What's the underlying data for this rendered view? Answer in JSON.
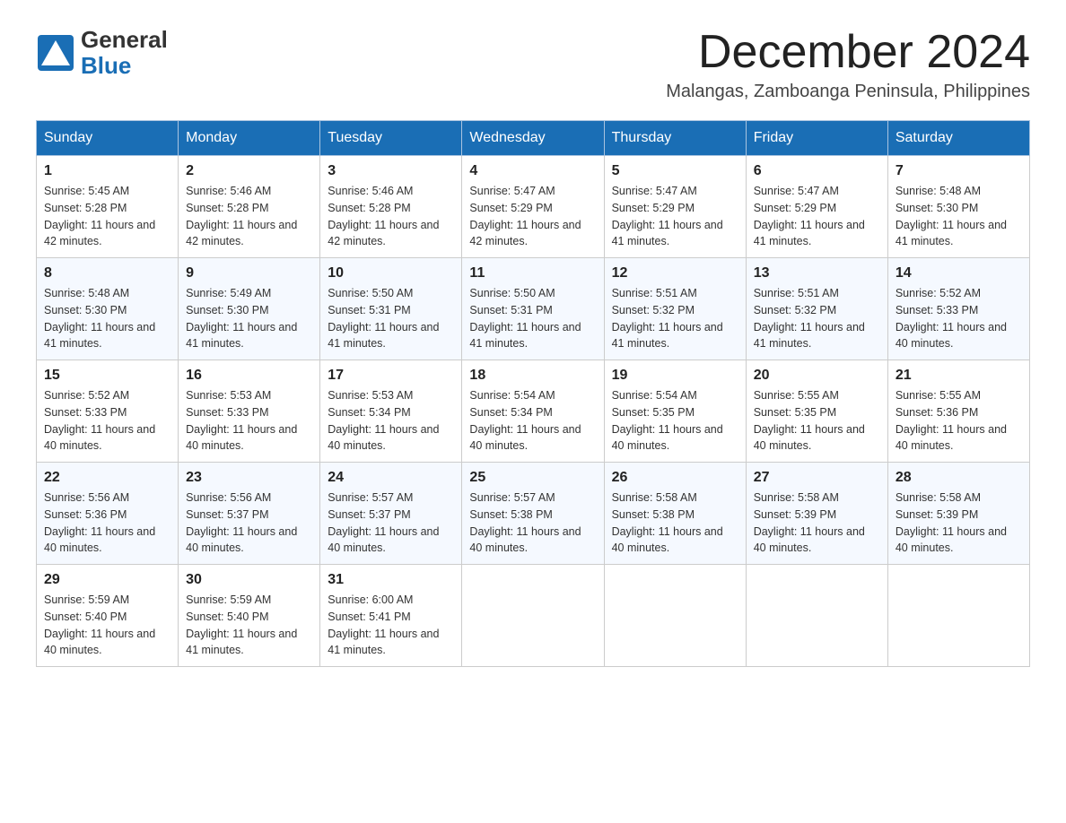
{
  "header": {
    "logo_general": "General",
    "logo_blue": "Blue",
    "month_title": "December 2024",
    "location": "Malangas, Zamboanga Peninsula, Philippines"
  },
  "weekdays": [
    "Sunday",
    "Monday",
    "Tuesday",
    "Wednesday",
    "Thursday",
    "Friday",
    "Saturday"
  ],
  "weeks": [
    [
      {
        "day": "1",
        "sunrise": "5:45 AM",
        "sunset": "5:28 PM",
        "daylight": "11 hours and 42 minutes."
      },
      {
        "day": "2",
        "sunrise": "5:46 AM",
        "sunset": "5:28 PM",
        "daylight": "11 hours and 42 minutes."
      },
      {
        "day": "3",
        "sunrise": "5:46 AM",
        "sunset": "5:28 PM",
        "daylight": "11 hours and 42 minutes."
      },
      {
        "day": "4",
        "sunrise": "5:47 AM",
        "sunset": "5:29 PM",
        "daylight": "11 hours and 42 minutes."
      },
      {
        "day": "5",
        "sunrise": "5:47 AM",
        "sunset": "5:29 PM",
        "daylight": "11 hours and 41 minutes."
      },
      {
        "day": "6",
        "sunrise": "5:47 AM",
        "sunset": "5:29 PM",
        "daylight": "11 hours and 41 minutes."
      },
      {
        "day": "7",
        "sunrise": "5:48 AM",
        "sunset": "5:30 PM",
        "daylight": "11 hours and 41 minutes."
      }
    ],
    [
      {
        "day": "8",
        "sunrise": "5:48 AM",
        "sunset": "5:30 PM",
        "daylight": "11 hours and 41 minutes."
      },
      {
        "day": "9",
        "sunrise": "5:49 AM",
        "sunset": "5:30 PM",
        "daylight": "11 hours and 41 minutes."
      },
      {
        "day": "10",
        "sunrise": "5:50 AM",
        "sunset": "5:31 PM",
        "daylight": "11 hours and 41 minutes."
      },
      {
        "day": "11",
        "sunrise": "5:50 AM",
        "sunset": "5:31 PM",
        "daylight": "11 hours and 41 minutes."
      },
      {
        "day": "12",
        "sunrise": "5:51 AM",
        "sunset": "5:32 PM",
        "daylight": "11 hours and 41 minutes."
      },
      {
        "day": "13",
        "sunrise": "5:51 AM",
        "sunset": "5:32 PM",
        "daylight": "11 hours and 41 minutes."
      },
      {
        "day": "14",
        "sunrise": "5:52 AM",
        "sunset": "5:33 PM",
        "daylight": "11 hours and 40 minutes."
      }
    ],
    [
      {
        "day": "15",
        "sunrise": "5:52 AM",
        "sunset": "5:33 PM",
        "daylight": "11 hours and 40 minutes."
      },
      {
        "day": "16",
        "sunrise": "5:53 AM",
        "sunset": "5:33 PM",
        "daylight": "11 hours and 40 minutes."
      },
      {
        "day": "17",
        "sunrise": "5:53 AM",
        "sunset": "5:34 PM",
        "daylight": "11 hours and 40 minutes."
      },
      {
        "day": "18",
        "sunrise": "5:54 AM",
        "sunset": "5:34 PM",
        "daylight": "11 hours and 40 minutes."
      },
      {
        "day": "19",
        "sunrise": "5:54 AM",
        "sunset": "5:35 PM",
        "daylight": "11 hours and 40 minutes."
      },
      {
        "day": "20",
        "sunrise": "5:55 AM",
        "sunset": "5:35 PM",
        "daylight": "11 hours and 40 minutes."
      },
      {
        "day": "21",
        "sunrise": "5:55 AM",
        "sunset": "5:36 PM",
        "daylight": "11 hours and 40 minutes."
      }
    ],
    [
      {
        "day": "22",
        "sunrise": "5:56 AM",
        "sunset": "5:36 PM",
        "daylight": "11 hours and 40 minutes."
      },
      {
        "day": "23",
        "sunrise": "5:56 AM",
        "sunset": "5:37 PM",
        "daylight": "11 hours and 40 minutes."
      },
      {
        "day": "24",
        "sunrise": "5:57 AM",
        "sunset": "5:37 PM",
        "daylight": "11 hours and 40 minutes."
      },
      {
        "day": "25",
        "sunrise": "5:57 AM",
        "sunset": "5:38 PM",
        "daylight": "11 hours and 40 minutes."
      },
      {
        "day": "26",
        "sunrise": "5:58 AM",
        "sunset": "5:38 PM",
        "daylight": "11 hours and 40 minutes."
      },
      {
        "day": "27",
        "sunrise": "5:58 AM",
        "sunset": "5:39 PM",
        "daylight": "11 hours and 40 minutes."
      },
      {
        "day": "28",
        "sunrise": "5:58 AM",
        "sunset": "5:39 PM",
        "daylight": "11 hours and 40 minutes."
      }
    ],
    [
      {
        "day": "29",
        "sunrise": "5:59 AM",
        "sunset": "5:40 PM",
        "daylight": "11 hours and 40 minutes."
      },
      {
        "day": "30",
        "sunrise": "5:59 AM",
        "sunset": "5:40 PM",
        "daylight": "11 hours and 41 minutes."
      },
      {
        "day": "31",
        "sunrise": "6:00 AM",
        "sunset": "5:41 PM",
        "daylight": "11 hours and 41 minutes."
      },
      null,
      null,
      null,
      null
    ]
  ]
}
